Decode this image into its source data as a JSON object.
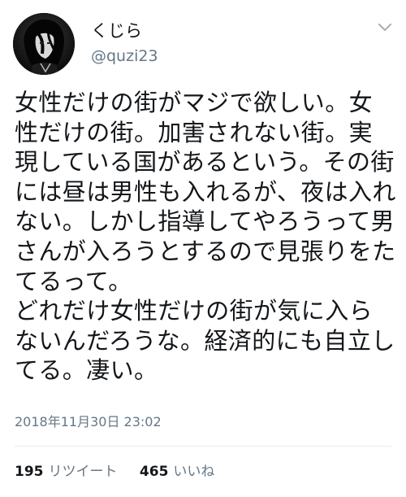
{
  "user": {
    "display_name": "くじら",
    "handle": "@quzi23"
  },
  "tweet": {
    "text": "女性だけの街がマジで欲しい。女性だけの街。加害されない街。実現している国があるという。その街には昼は男性も入れるが、夜は入れない。しかし指導してやろうって男さんが入ろうとするので見張りをたてるって。\nどれだけ女性だけの街が気に入らないんだろうな。経済的にも自立してる。凄い。",
    "timestamp": "2018年11月30日 23:02"
  },
  "stats": {
    "retweets_count": "195",
    "retweets_label": "リツイート",
    "likes_count": "465",
    "likes_label": "いいね"
  },
  "icons": {
    "avatar": "user-avatar-image",
    "menu": "chevron-down-icon"
  },
  "colors": {
    "text_primary": "#14171a",
    "text_secondary": "#657786",
    "divider": "#e6ecf0"
  }
}
